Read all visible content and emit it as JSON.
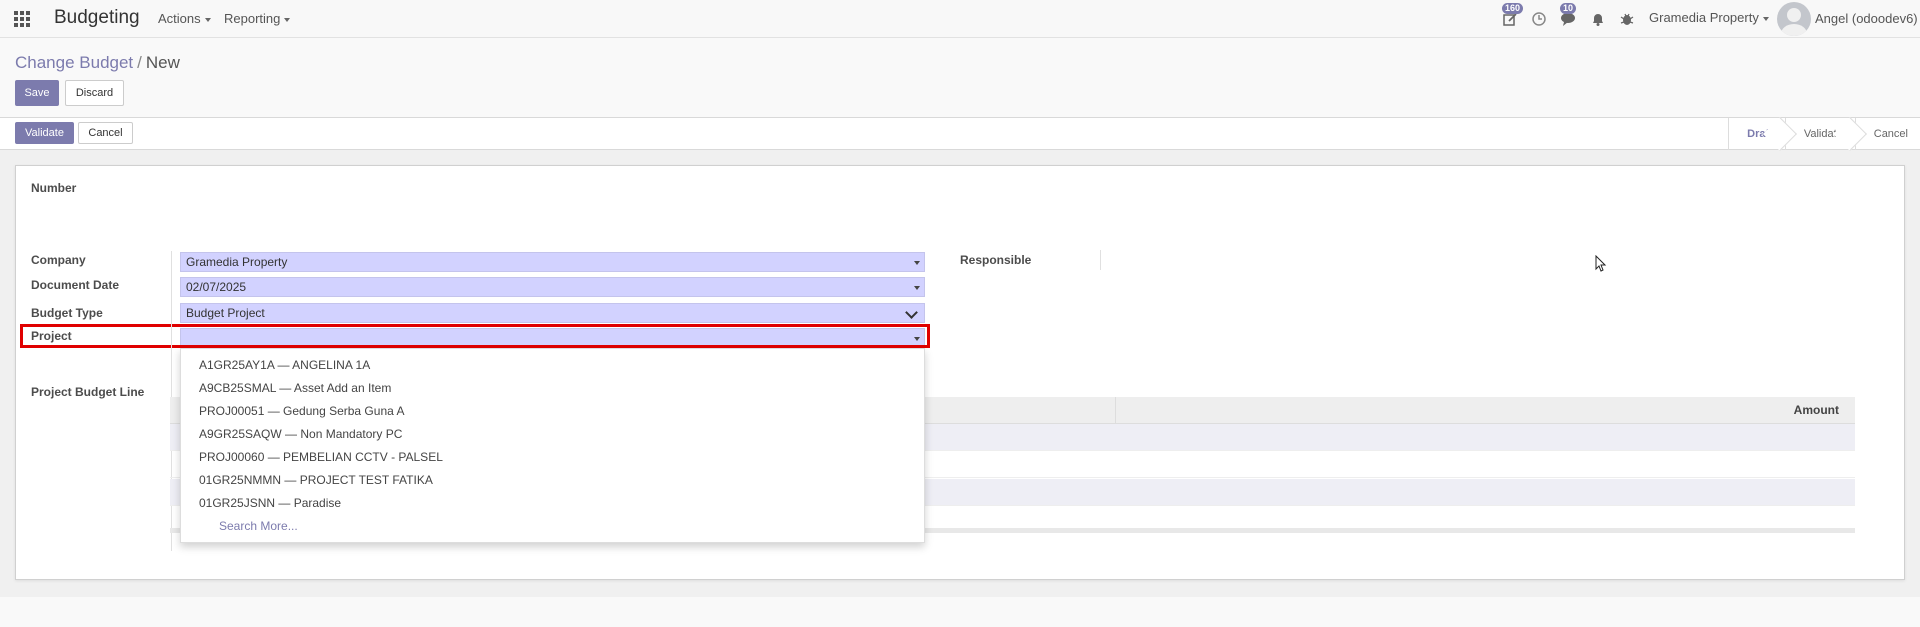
{
  "navbar": {
    "app_title": "Budgeting",
    "menus": [
      "Actions",
      "Reporting"
    ],
    "activity_badge": "160",
    "messages_badge": "10",
    "company": "Gramedia Property",
    "user": "Angel (odoodev6)"
  },
  "breadcrumb": {
    "parent": "Change Budget",
    "separator": "/",
    "current": "New"
  },
  "buttons": {
    "save": "Save",
    "discard": "Discard",
    "validate": "Validate",
    "cancel": "Cancel"
  },
  "status_steps": [
    "Draft",
    "Validate",
    "Cancel"
  ],
  "status_active": "Draft",
  "form": {
    "number_label": "Number",
    "company_label": "Company",
    "company_value": "Gramedia Property",
    "document_date_label": "Document Date",
    "document_date_value": "02/07/2025",
    "budget_type_label": "Budget Type",
    "budget_type_value": "Budget Project",
    "project_label": "Project",
    "project_value": "",
    "responsible_label": "Responsible",
    "project_budget_line_label": "Project Budget Line",
    "amount_header": "Amount"
  },
  "project_dropdown": {
    "options": [
      "A1GR25AY1A — ANGELINA 1A",
      "A9CB25SMAL — Asset Add an Item",
      "PROJ00051 — Gedung Serba Guna A",
      "A9GR25SAQW — Non Mandatory PC",
      "PROJ00060 — PEMBELIAN CCTV - PALSEL",
      "01GR25NMMN — PROJECT TEST FATIKA",
      "01GR25JSNN — Paradise"
    ],
    "search_more": "Search More..."
  },
  "colors": {
    "accent": "#7c7bad",
    "required_field": "#d2d2ff",
    "highlight_box": "#e00000"
  }
}
